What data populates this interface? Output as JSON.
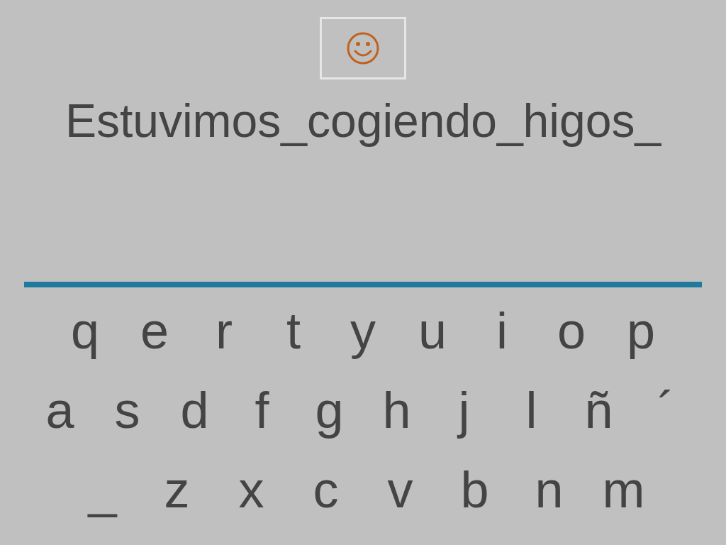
{
  "sentence": "Estuvimos_cogiendo_higos_",
  "keyboard": {
    "rows": [
      [
        "q",
        "e",
        "r",
        "t",
        "y",
        "u",
        "i",
        "o",
        "p"
      ],
      [
        "a",
        "s",
        "d",
        "f",
        "g",
        "h",
        "j",
        "l",
        "ñ",
        "´"
      ],
      [
        "_",
        "z",
        "x",
        "c",
        "v",
        "b",
        "n",
        "m"
      ]
    ]
  }
}
